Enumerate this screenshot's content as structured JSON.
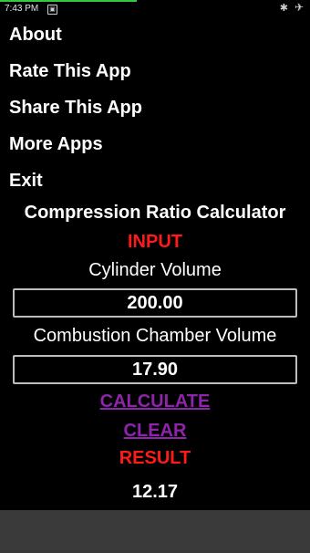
{
  "status_bar": {
    "time": "7:43 PM",
    "notification_icon": "image-notification-icon",
    "bluetooth_icon": "bluetooth-icon",
    "airplane_icon": "airplane-mode-icon",
    "progress_fraction": 0.44,
    "progress_color": "#2ecc40"
  },
  "menu": {
    "items": [
      {
        "label": "About"
      },
      {
        "label": "Rate This App"
      },
      {
        "label": "Share This App"
      },
      {
        "label": "More Apps"
      },
      {
        "label": "Exit"
      }
    ]
  },
  "calculator": {
    "title": "Compression Ratio Calculator",
    "input_header": "INPUT",
    "cylinder_volume_label": "Cylinder Volume",
    "cylinder_volume_value": "200.00",
    "combustion_chamber_label": "Combustion Chamber Volume",
    "combustion_chamber_value": "17.90",
    "calculate_label": "CALCULATE",
    "clear_label": "CLEAR",
    "result_header": "RESULT",
    "result_value": "12.17"
  },
  "colors": {
    "background": "#000000",
    "text": "#ffffff",
    "header_red": "#ff1a1a",
    "action_purple": "#8e24aa",
    "nav_bar": "#3a3a3a"
  }
}
